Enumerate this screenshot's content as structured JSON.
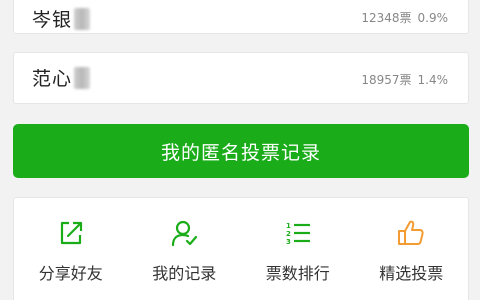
{
  "candidates": [
    {
      "name": "岑银",
      "votes": "12348票",
      "percent": "0.9%"
    },
    {
      "name": "范心",
      "votes": "18957票",
      "percent": "1.4%"
    }
  ],
  "record_button": {
    "label": "我的匿名投票记录"
  },
  "actions": [
    {
      "label": "分享好友",
      "icon": "share-icon"
    },
    {
      "label": "我的记录",
      "icon": "user-check-icon"
    },
    {
      "label": "票数排行",
      "icon": "ranking-list-icon"
    },
    {
      "label": "精选投票",
      "icon": "thumbs-up-icon"
    }
  ],
  "colors": {
    "primary_green": "#1aad19",
    "icon_green": "#1aad19",
    "thumb_orange": "#f39c33",
    "background": "#f2f2f2"
  }
}
